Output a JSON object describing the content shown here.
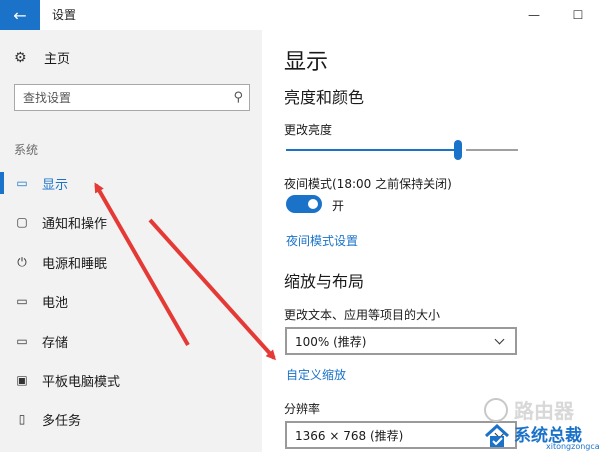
{
  "window": {
    "title": "设置",
    "back_icon": "←",
    "minimize_icon": "—",
    "maximize_icon": "☐"
  },
  "sidebar": {
    "home": {
      "label": "主页",
      "icon": "⚙"
    },
    "search": {
      "placeholder": "查找设置",
      "icon": "⚲"
    },
    "section_label": "系统",
    "items": [
      {
        "label": "显示",
        "icon": "▭",
        "active": true
      },
      {
        "label": "通知和操作",
        "icon": "▢",
        "active": false
      },
      {
        "label": "电源和睡眠",
        "icon": "⏻",
        "active": false
      },
      {
        "label": "电池",
        "icon": "▭",
        "active": false
      },
      {
        "label": "存储",
        "icon": "▭",
        "active": false
      },
      {
        "label": "平板电脑模式",
        "icon": "▣",
        "active": false
      },
      {
        "label": "多任务",
        "icon": "▯",
        "active": false
      }
    ]
  },
  "main": {
    "title": "显示",
    "brightness_section": {
      "heading": "亮度和颜色",
      "brightness_label": "更改亮度",
      "brightness_fraction": 0.74,
      "night_mode_label": "夜间模式(18:00 之前保持关闭)",
      "night_mode_state": "开",
      "night_mode_on": true,
      "night_settings_link": "夜间模式设置"
    },
    "scale_section": {
      "heading": "缩放与布局",
      "text_size_label": "更改文本、应用等项目的大小",
      "text_size_value": "100% (推荐)",
      "custom_scale_link": "自定义缩放",
      "resolution_label": "分辨率",
      "resolution_value": "1366 × 768 (推荐)"
    }
  },
  "watermark": {
    "router_text": "路由器",
    "site_title": "系统总裁",
    "site_url": "xitongzongcai.com"
  },
  "colors": {
    "accent": "#1a73c9",
    "annotation_arrow": "#e53935",
    "sidebar_bg": "#f2f2f2"
  }
}
